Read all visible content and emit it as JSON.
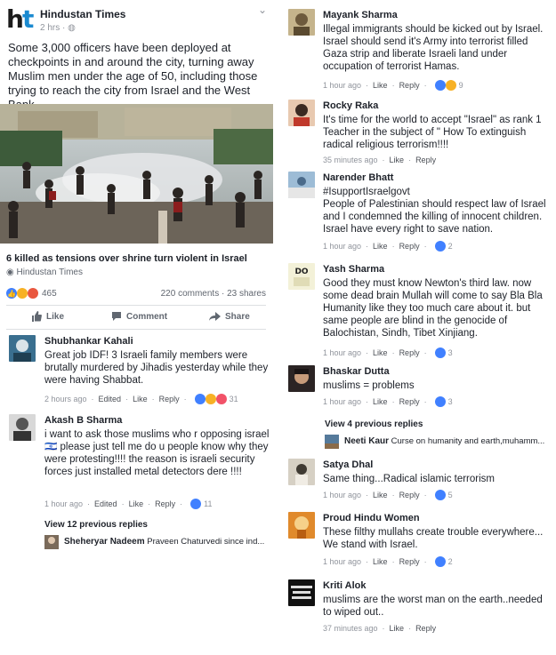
{
  "post": {
    "page_name": "Hindustan Times",
    "meta": "2 hrs · ",
    "text": "Some 3,000 officers have been deployed at checkpoints in and around the city, turning away Muslim men under the age of 50, including those trying to reach the city from Israel and the West Bank.",
    "link_title": "6 killed as tensions over shrine turn violent in Israel",
    "link_source": "Hindustan Times",
    "reaction_count": "465",
    "stats": "220 comments · 23 shares",
    "actions": {
      "like": "Like",
      "comment": "Comment",
      "share": "Share"
    }
  },
  "meta_labels": {
    "like": "Like",
    "reply": "Reply",
    "edited": "Edited"
  },
  "left_comments": [
    {
      "name": "Shubhankar Kahali",
      "text": "Great job IDF! 3 Israeli family members were brutally murdered by  Jihadis yesterday while they were having Shabbat.",
      "time": "2 hours ago",
      "reactions": "31"
    },
    {
      "name": "Akash B Sharma",
      "text": "i want to ask those muslims who r opposing israel 🇮🇱 please just tell me do u people know why they were protesting!!!! the reason is israeli security forces just installed metal detectors dere !!!!",
      "time": "1 hour ago",
      "reactions": "11"
    }
  ],
  "left_view_prev": "View 12 previous replies",
  "left_reply": {
    "name": "Sheheryar Nadeem",
    "text": "Praveen Chaturvedi since ind..."
  },
  "right_comments": [
    {
      "name": "Mayank Sharma",
      "text": "Illegal immigrants should be kicked out by Israel.  Israel should send it's Army into terrorist filled Gaza strip and liberate Israeli land under occupation of terrorist Hamas.",
      "time": "1 hour ago",
      "reactions": "9"
    },
    {
      "name": "Rocky Raka",
      "text": "It's time for the world to accept \"Israel\" as rank 1 Teacher in the subject of \" How To extinguish radical religious terrorism!!!!",
      "time": "35 minutes ago"
    },
    {
      "name": "Narender Bhatt",
      "text": "#IsupportIsraelgovt\nPeople of Palestinian should respect law of Israel and I condemned the killing of innocent children. Israel have every right to save nation.",
      "time": "1 hour ago",
      "reactions": "2"
    },
    {
      "name": "Yash Sharma",
      "text": "Good they must know Newton's third law. now some dead brain Mullah will come to say Bla Bla Humanity like they too much care about it. but same people are blind in the genocide of Balochistan, Sindh, Tibet Xinjiang.",
      "time": "1 hour ago",
      "reactions": "3",
      "avatar_text": "DO"
    },
    {
      "name": "Bhaskar Dutta",
      "text": "muslims = problems",
      "time": "1 hour ago",
      "reactions": "3"
    },
    {
      "name": "Satya Dhal",
      "text": "Same thing...Radical islamic terrorism",
      "time": "1 hour ago",
      "reactions": "5"
    },
    {
      "name": "Proud Hindu Women",
      "text": "These filthy mullahs create trouble everywhere... We stand with Israel.",
      "time": "1 hour ago",
      "reactions": "2"
    },
    {
      "name": "Kriti Alok",
      "text": "muslims are the worst man on the earth..needed to wiped out..",
      "time": "37 minutes ago"
    }
  ],
  "right_view_prev": "View 4 previous replies",
  "right_reply": {
    "name": "Neeti Kaur",
    "text": "Curse on humanity and earth,muhamm..."
  },
  "colors": {
    "fb_blue": "#4080ff",
    "link_gray": "#4b4f56",
    "meta_gray": "#90949c",
    "ht_blue": "#1b8ad0"
  }
}
